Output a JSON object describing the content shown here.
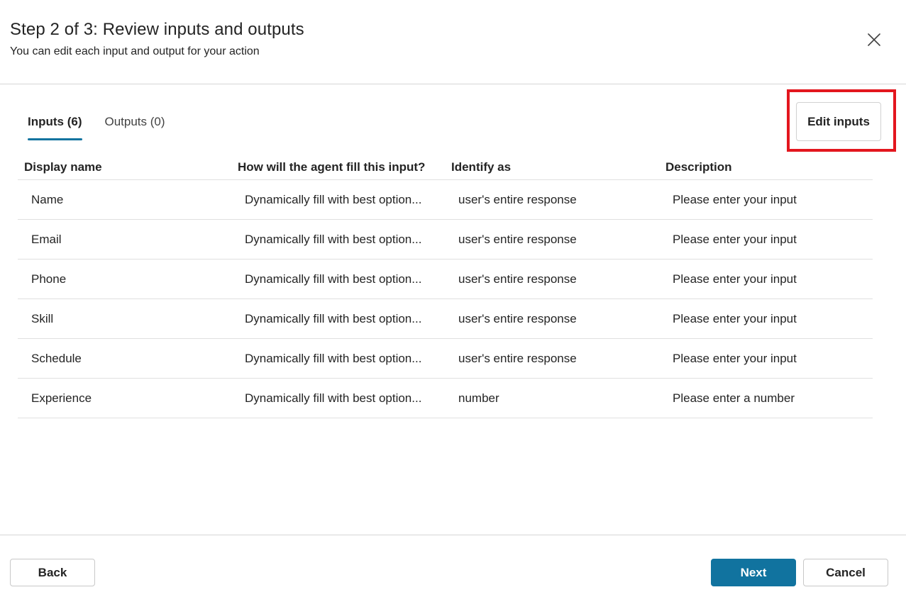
{
  "header": {
    "title": "Step 2 of 3: Review inputs and outputs",
    "subtitle": "You can edit each input and output for your action"
  },
  "tabs": [
    {
      "label": "Inputs (6)",
      "active": true
    },
    {
      "label": "Outputs (0)",
      "active": false
    }
  ],
  "edit_button": {
    "label": "Edit inputs"
  },
  "table": {
    "columns": [
      "Display name",
      "How will the agent fill this input?",
      "Identify as",
      "Description"
    ],
    "rows": [
      [
        "Name",
        "Dynamically fill with best option...",
        "user's entire response",
        "Please enter your input"
      ],
      [
        "Email",
        "Dynamically fill with best option...",
        "user's entire response",
        "Please enter your input"
      ],
      [
        "Phone",
        "Dynamically fill with best option...",
        "user's entire response",
        "Please enter your input"
      ],
      [
        "Skill",
        "Dynamically fill with best option...",
        "user's entire response",
        "Please enter your input"
      ],
      [
        "Schedule",
        "Dynamically fill with best option...",
        "user's entire response",
        "Please enter your input"
      ],
      [
        "Experience",
        "Dynamically fill with best option...",
        "number",
        "Please enter a number"
      ]
    ]
  },
  "footer": {
    "back_label": "Back",
    "next_label": "Next",
    "cancel_label": "Cancel"
  },
  "colors": {
    "accent": "#11739f",
    "highlight": "#e3161e"
  },
  "icons": {
    "close": "close-icon"
  }
}
